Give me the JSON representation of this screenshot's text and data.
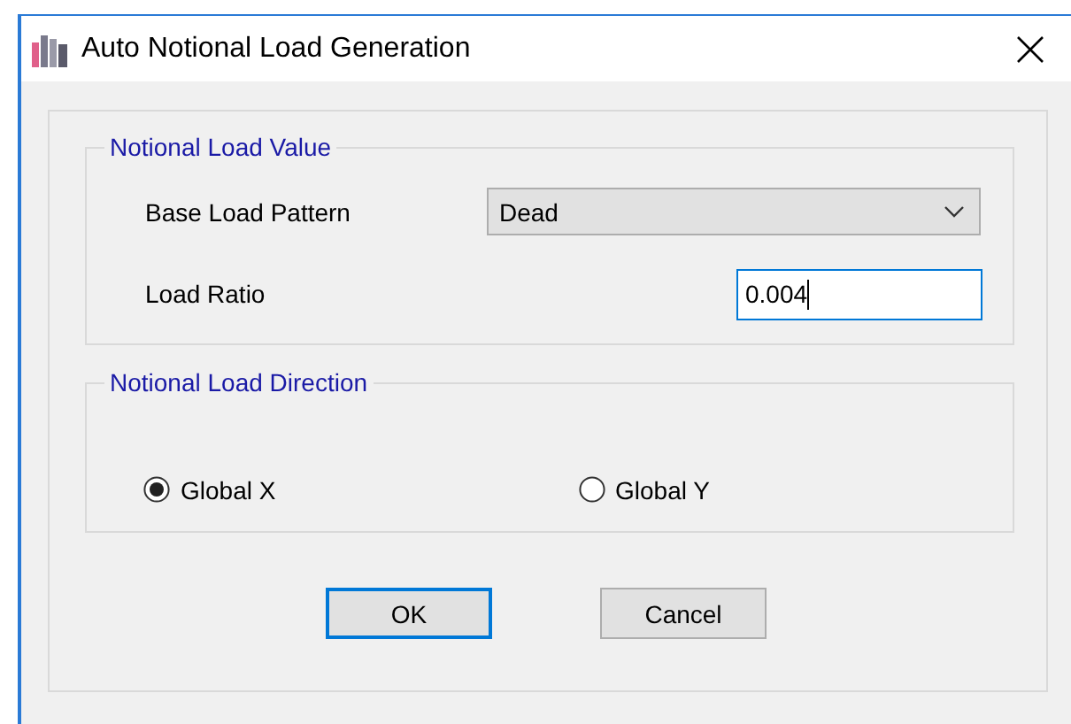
{
  "window": {
    "title": "Auto Notional Load Generation"
  },
  "value_group": {
    "title": "Notional Load Value",
    "base_load_pattern": {
      "label": "Base Load Pattern",
      "value": "Dead"
    },
    "load_ratio": {
      "label": "Load Ratio",
      "value": "0.004"
    }
  },
  "direction_group": {
    "title": "Notional Load Direction",
    "options": [
      {
        "label": "Global X",
        "selected": true
      },
      {
        "label": "Global Y",
        "selected": false
      }
    ]
  },
  "buttons": [
    {
      "label": "OK",
      "focused": true
    },
    {
      "label": "Cancel",
      "focused": false
    }
  ]
}
